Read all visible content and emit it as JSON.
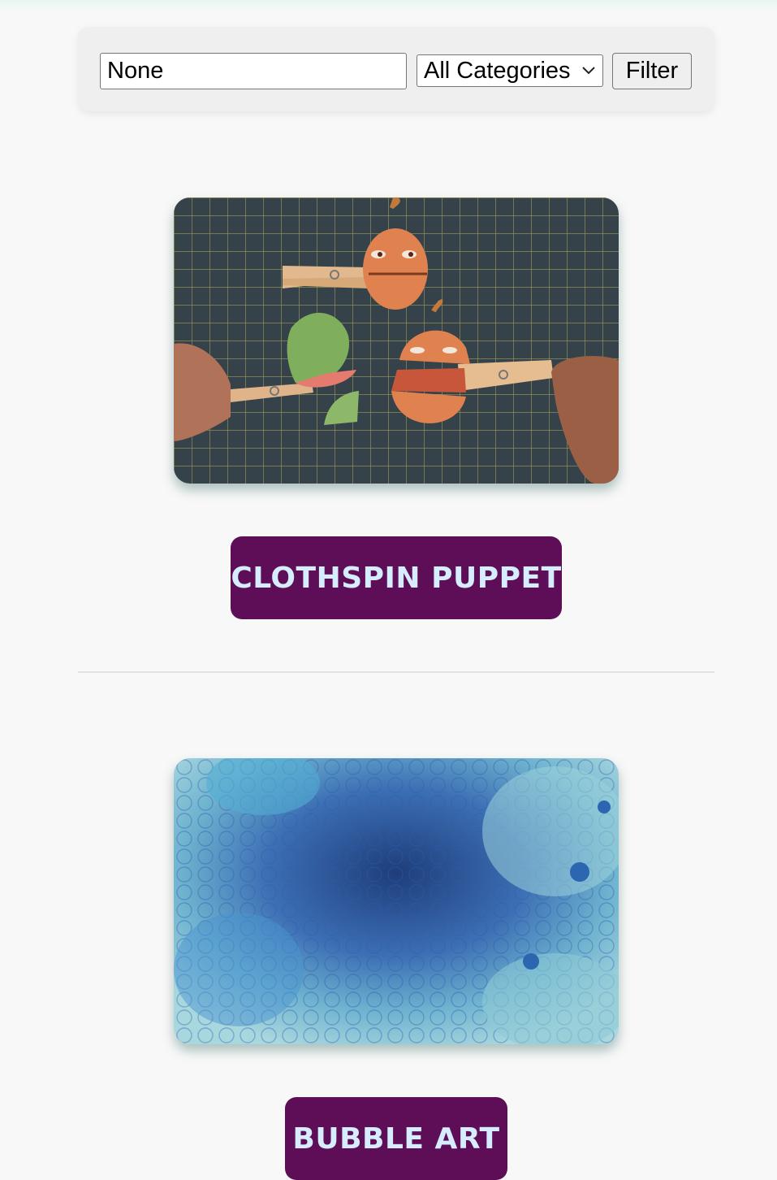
{
  "search": {
    "value": "None"
  },
  "category_select": {
    "selected": "All Categories"
  },
  "filter_button": {
    "label": "Filter"
  },
  "crafts": [
    {
      "title": "CLOTHSPIN PUPPET",
      "image": "clothespin-puppet-photo"
    },
    {
      "title": "BUBBLE ART",
      "image": "bubble-art-photo"
    }
  ],
  "colors": {
    "title_bg": "#5e0e57",
    "title_text": "#d6ecff",
    "page_bg": "#f8f8f8"
  }
}
